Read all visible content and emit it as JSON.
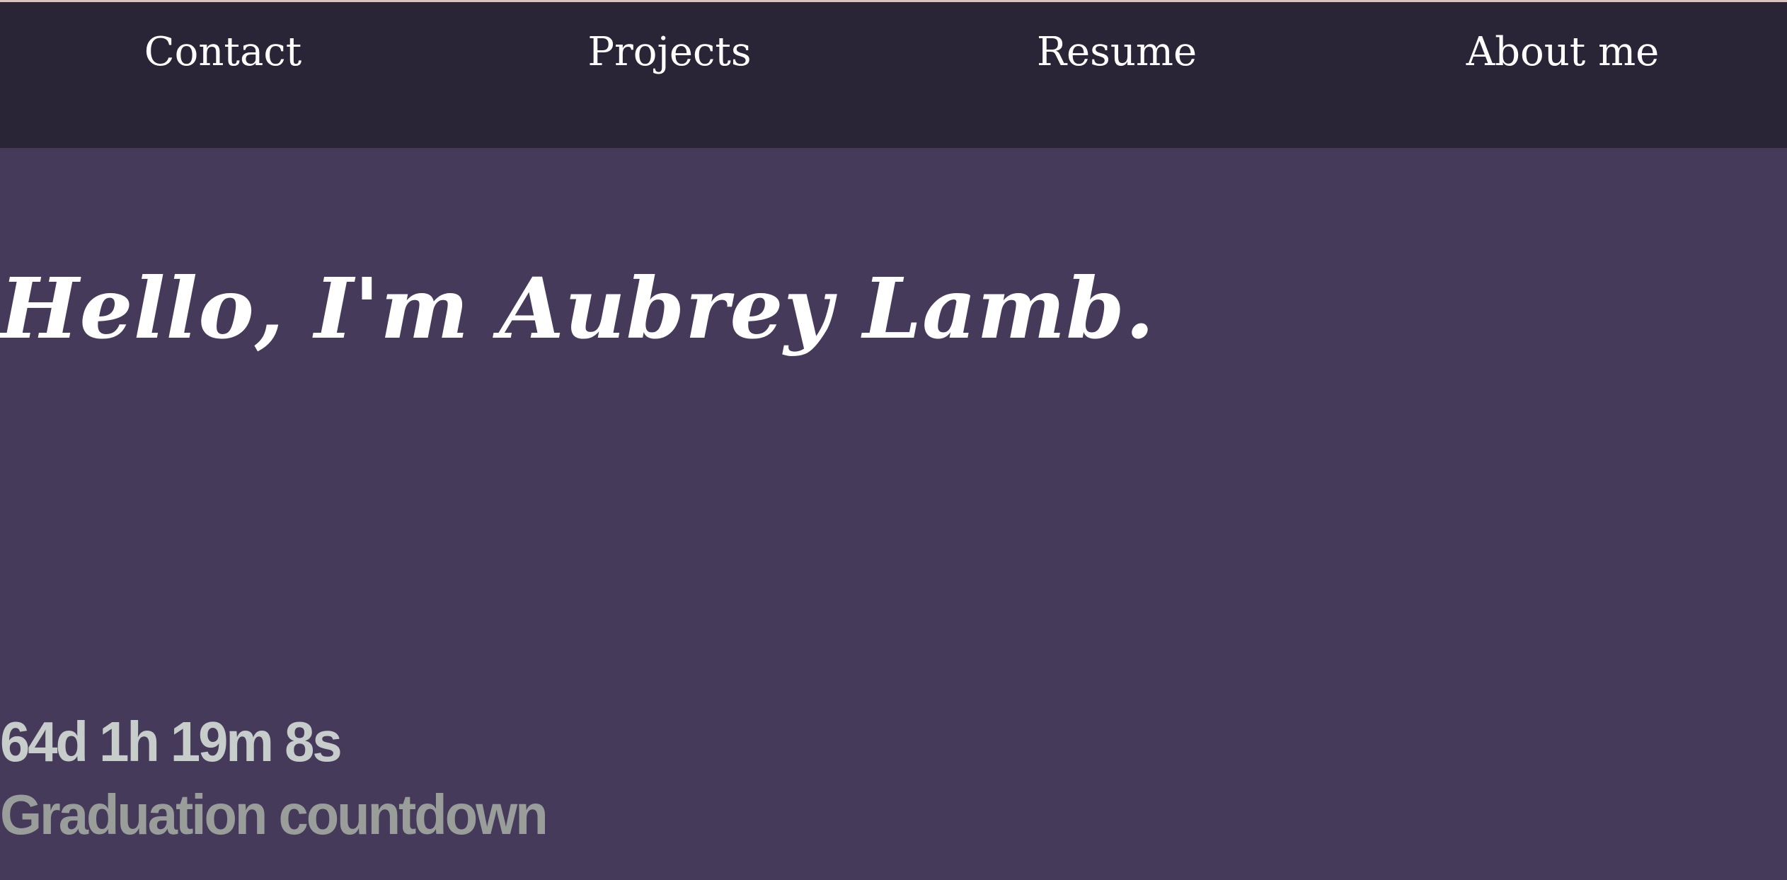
{
  "nav": {
    "items": [
      {
        "label": "Contact"
      },
      {
        "label": "Projects"
      },
      {
        "label": "Resume"
      },
      {
        "label": "About me"
      }
    ]
  },
  "hero": {
    "title": "Hello, I'm Aubrey Lamb."
  },
  "countdown": {
    "value": "64d 1h 19m 8s",
    "label": "Graduation countdown"
  },
  "colors": {
    "background": "#463a5a",
    "navbar": "#292436",
    "accent_line": "#d9c2c0",
    "text_primary": "#ffffff",
    "countdown_text": "#c7cdca",
    "countdown_label": "#9a9e9a"
  }
}
